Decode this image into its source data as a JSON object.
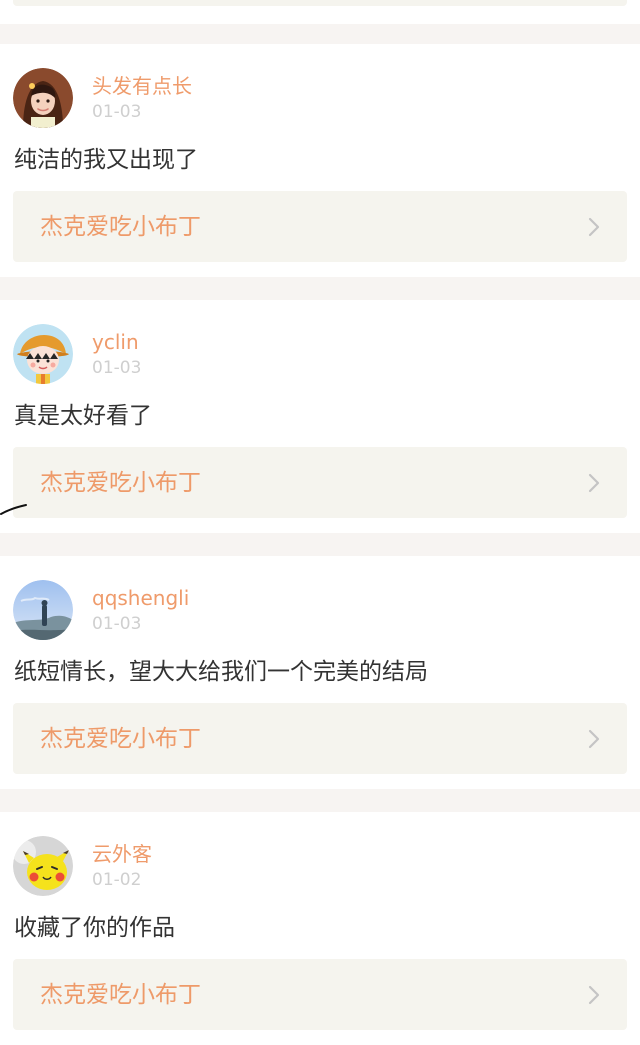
{
  "feed": {
    "cards": [
      {
        "username": "头发有点长",
        "date": "01-03",
        "comment": "纯洁的我又出现了",
        "work_title": "杰克爱吃小布丁",
        "avatar_icon": "girl-avatar-icon"
      },
      {
        "username": "yclin",
        "date": "01-03",
        "comment": "真是太好看了",
        "work_title": "杰克爱吃小布丁",
        "avatar_icon": "cartoon-avatar-icon"
      },
      {
        "username": "qqshengli",
        "date": "01-03",
        "comment": "纸短情长，望大大给我们一个完美的结局",
        "work_title": "杰克爱吃小布丁",
        "avatar_icon": "landscape-avatar-icon"
      },
      {
        "username": "云外客",
        "date": "01-02",
        "comment": "收藏了你的作品",
        "work_title": "杰克爱吃小布丁",
        "avatar_icon": "pikachu-avatar-icon"
      }
    ]
  },
  "colors": {
    "background": "#f7f4f2",
    "card": "#ffffff",
    "username": "#ef9b6b",
    "date": "#cfcfcf",
    "comment": "#333333",
    "work_link_bg": "#f5f4ee",
    "work_title": "#ee9a69",
    "chevron": "#c4c4c4"
  }
}
